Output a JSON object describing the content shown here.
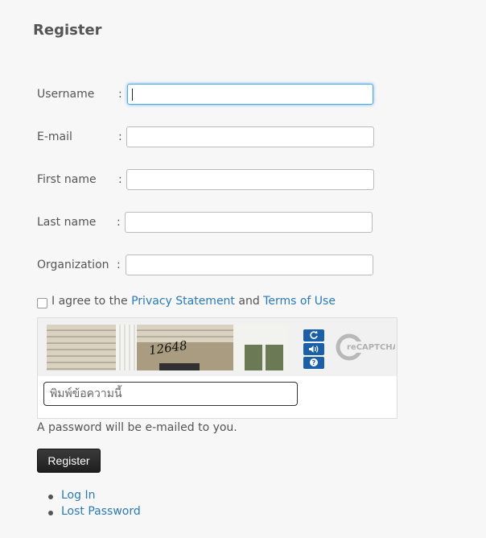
{
  "page": {
    "title": "Register"
  },
  "form": {
    "fields": [
      {
        "label": "Username",
        "colon": ":",
        "value": ""
      },
      {
        "label": "E-mail",
        "colon": ":",
        "value": ""
      },
      {
        "label": "First name",
        "colon": ":",
        "value": ""
      },
      {
        "label": "Last name",
        "colon": ":",
        "value": ""
      },
      {
        "label": "Organization",
        "colon": ":",
        "value": ""
      }
    ],
    "agree": {
      "prefix": "I agree to the",
      "privacy_link": "Privacy Statement",
      "and": "and",
      "terms_link": "Terms of Use",
      "checked": false
    }
  },
  "captcha": {
    "image_text": "12648",
    "input_placeholder": "พิมพ์ข้อความนี้",
    "reload_icon": "refresh-icon",
    "audio_icon": "speaker-icon",
    "help_icon": "help-icon",
    "logo_text": "reCAPTCHA™",
    "accent_color": "#1b5fa8"
  },
  "note": "A password will be e-mailed to you.",
  "register_button": "Register",
  "links": [
    "Log In",
    "Lost Password"
  ],
  "colors": {
    "link": "#2a7ab8",
    "focus": "#4ea9e8",
    "button": "#262626"
  }
}
